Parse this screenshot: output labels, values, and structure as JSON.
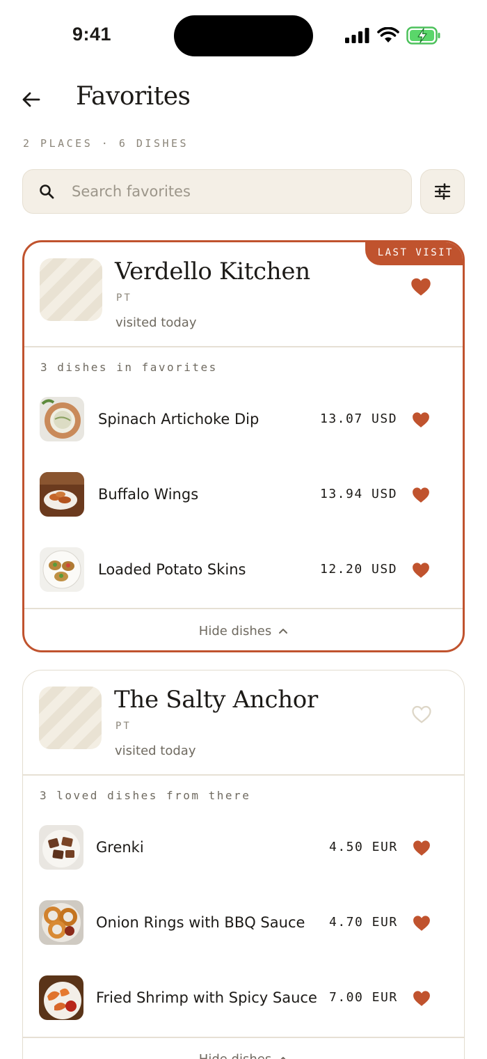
{
  "status_bar": {
    "time": "9:41"
  },
  "header": {
    "title": "Favorites",
    "subtitle": "2 PLACES · 6 DISHES"
  },
  "search": {
    "placeholder": "Search favorites",
    "value": ""
  },
  "colors": {
    "accent": "#c0532e",
    "surface": "#f4efe6",
    "muted": "#8b8579"
  },
  "places": [
    {
      "name": "Verdello Kitchen",
      "code": "PT",
      "visited": "visited today",
      "badge": "LAST VISIT",
      "favorited": true,
      "dishes_label": "3 dishes in favorites",
      "dishes": [
        {
          "name": "Spinach Artichoke Dip",
          "price": "13.07 USD",
          "favorited": true
        },
        {
          "name": "Buffalo Wings",
          "price": "13.94 USD",
          "favorited": true
        },
        {
          "name": "Loaded Potato Skins",
          "price": "12.20 USD",
          "favorited": true
        }
      ],
      "toggle_label": "Hide dishes"
    },
    {
      "name": "The Salty Anchor",
      "code": "PT",
      "visited": "visited today",
      "favorited": false,
      "dishes_label": "3 loved dishes from there",
      "dishes": [
        {
          "name": "Grenki",
          "price": "4.50 EUR",
          "favorited": true
        },
        {
          "name": "Onion Rings with BBQ Sauce",
          "price": "4.70 EUR",
          "favorited": true
        },
        {
          "name": "Fried Shrimp with Spicy Sauce",
          "price": "7.00 EUR",
          "favorited": true
        }
      ],
      "toggle_label": "Hide dishes"
    }
  ]
}
